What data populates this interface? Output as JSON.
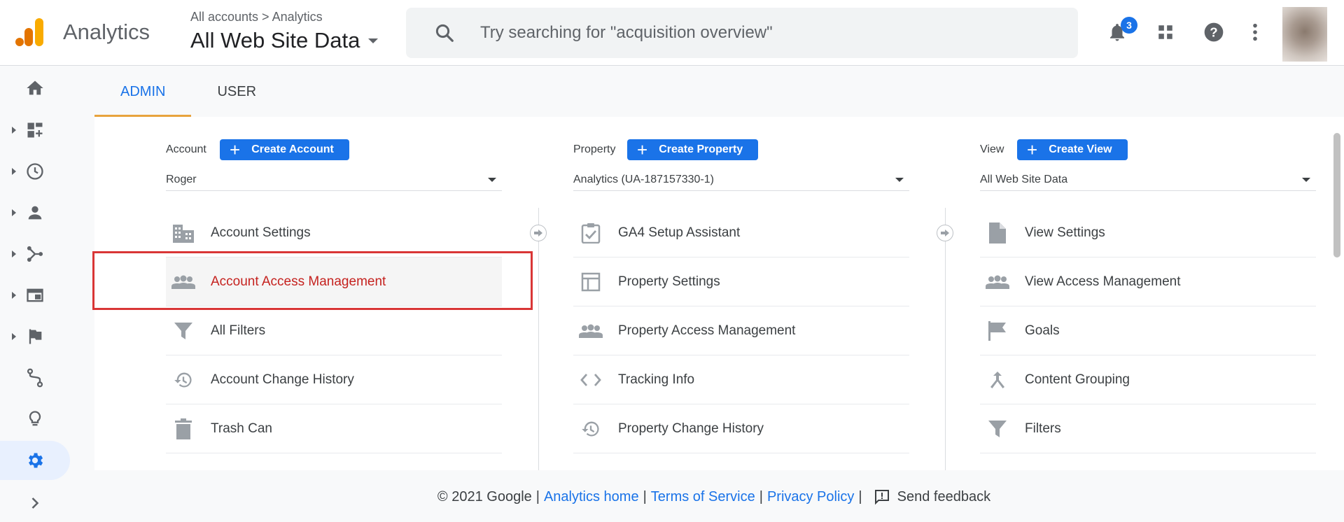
{
  "header": {
    "app_name": "Analytics",
    "breadcrumb": "All accounts > Analytics",
    "view_name": "All Web Site Data",
    "search_placeholder": "Try searching for \"acquisition overview\"",
    "notification_count": "3",
    "icons": [
      "analytics-logo-icon",
      "search-icon",
      "bell-icon",
      "apps-grid-icon",
      "help-icon",
      "more-vert-icon"
    ]
  },
  "tabs": [
    {
      "label": "ADMIN",
      "active": true
    },
    {
      "label": "USER",
      "active": false
    }
  ],
  "rail": [
    "home-icon",
    "customization-icon",
    "realtime-icon",
    "audience-icon",
    "acquisition-icon",
    "behavior-icon",
    "conversions-icon",
    "attribution-icon",
    "discover-icon",
    "admin-gear-icon",
    "expand-icon"
  ],
  "columns": {
    "account": {
      "label": "Account",
      "create_label": "Create Account",
      "selected": "Roger",
      "items": [
        {
          "label": "Account Settings",
          "icon": "building-icon"
        },
        {
          "label": "Account Access Management",
          "icon": "people-icon",
          "highlighted": true
        },
        {
          "label": "All Filters",
          "icon": "filter-icon"
        },
        {
          "label": "Account Change History",
          "icon": "history-icon"
        },
        {
          "label": "Trash Can",
          "icon": "trash-icon"
        }
      ]
    },
    "property": {
      "label": "Property",
      "create_label": "Create Property",
      "selected": "Analytics (UA-187157330-1)",
      "items": [
        {
          "label": "GA4 Setup Assistant",
          "icon": "checklist-icon"
        },
        {
          "label": "Property Settings",
          "icon": "layout-icon"
        },
        {
          "label": "Property Access Management",
          "icon": "people-icon"
        },
        {
          "label": "Tracking Info",
          "icon": "code-icon"
        },
        {
          "label": "Property Change History",
          "icon": "history-icon"
        }
      ]
    },
    "view": {
      "label": "View",
      "create_label": "Create View",
      "selected": "All Web Site Data",
      "items": [
        {
          "label": "View Settings",
          "icon": "document-icon"
        },
        {
          "label": "View Access Management",
          "icon": "people-icon"
        },
        {
          "label": "Goals",
          "icon": "flag-icon"
        },
        {
          "label": "Content Grouping",
          "icon": "merge-icon"
        },
        {
          "label": "Filters",
          "icon": "filter-icon"
        }
      ]
    }
  },
  "footer": {
    "copyright": "© 2021 Google",
    "link_home": "Analytics home",
    "link_terms": "Terms of Service",
    "link_privacy": "Privacy Policy",
    "separator": "|",
    "feedback": "Send feedback"
  },
  "colors": {
    "accent": "#1a73e8",
    "highlight_text": "#c5221f",
    "highlight_box": "#d93636",
    "tab_underline": "#e8a33d"
  }
}
